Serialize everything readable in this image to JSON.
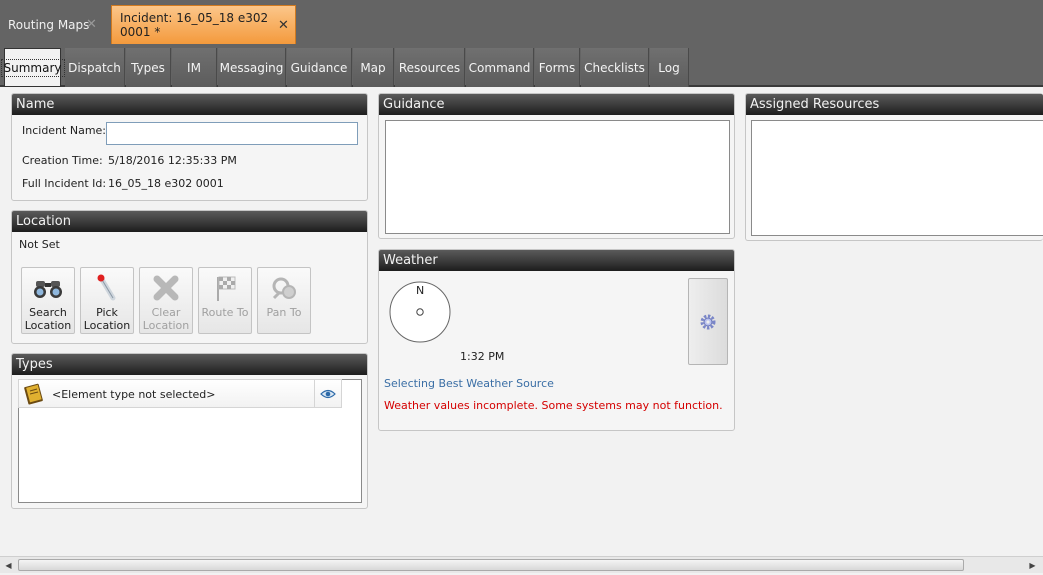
{
  "doc_tabs": [
    {
      "label": "Routing Maps",
      "active": false
    },
    {
      "label": "Incident: 16_05_18 e302 0001 *",
      "active": true
    }
  ],
  "close_glyph": "✕",
  "sub_tabs": [
    "Summary",
    "Dispatch",
    "Types",
    "IM",
    "Messaging",
    "Guidance",
    "Map",
    "Resources",
    "Command",
    "Forms",
    "Checklists",
    "Log"
  ],
  "active_sub_tab": "Summary",
  "name_panel": {
    "title": "Name",
    "incident_name_label": "Incident Name:",
    "incident_name_value": "",
    "creation_time_label": "Creation Time:",
    "creation_time_value": "5/18/2016 12:35:33 PM",
    "full_id_label": "Full Incident Id:",
    "full_id_value": "16_05_18 e302 0001"
  },
  "location_panel": {
    "title": "Location",
    "status": "Not Set",
    "buttons": [
      {
        "line1": "Search",
        "line2": "Location",
        "icon": "binoculars-icon",
        "enabled": true
      },
      {
        "line1": "Pick",
        "line2": "Location",
        "icon": "pick-pin-icon",
        "enabled": true
      },
      {
        "line1": "Clear",
        "line2": "Location",
        "icon": "clear-x-icon",
        "enabled": false
      },
      {
        "line1": "Route To",
        "line2": "",
        "icon": "checkered-flag-icon",
        "enabled": false
      },
      {
        "line1": "Pan To",
        "line2": "",
        "icon": "pan-icon",
        "enabled": false
      }
    ]
  },
  "types_panel": {
    "title": "Types",
    "row_text": "<Element type not selected>"
  },
  "guidance_panel": {
    "title": "Guidance"
  },
  "weather_panel": {
    "title": "Weather",
    "compass_letter": "N",
    "time": "1:32 PM",
    "source_text": "Selecting Best Weather Source",
    "warning_text": "Weather values incomplete. Some systems may not function.",
    "source_color": "#3a6ea5",
    "warning_color": "#d40000"
  },
  "resources_panel": {
    "title": "Assigned Resources"
  },
  "colors": {
    "active_tab": "#f49a3c",
    "chrome": "#646464"
  }
}
